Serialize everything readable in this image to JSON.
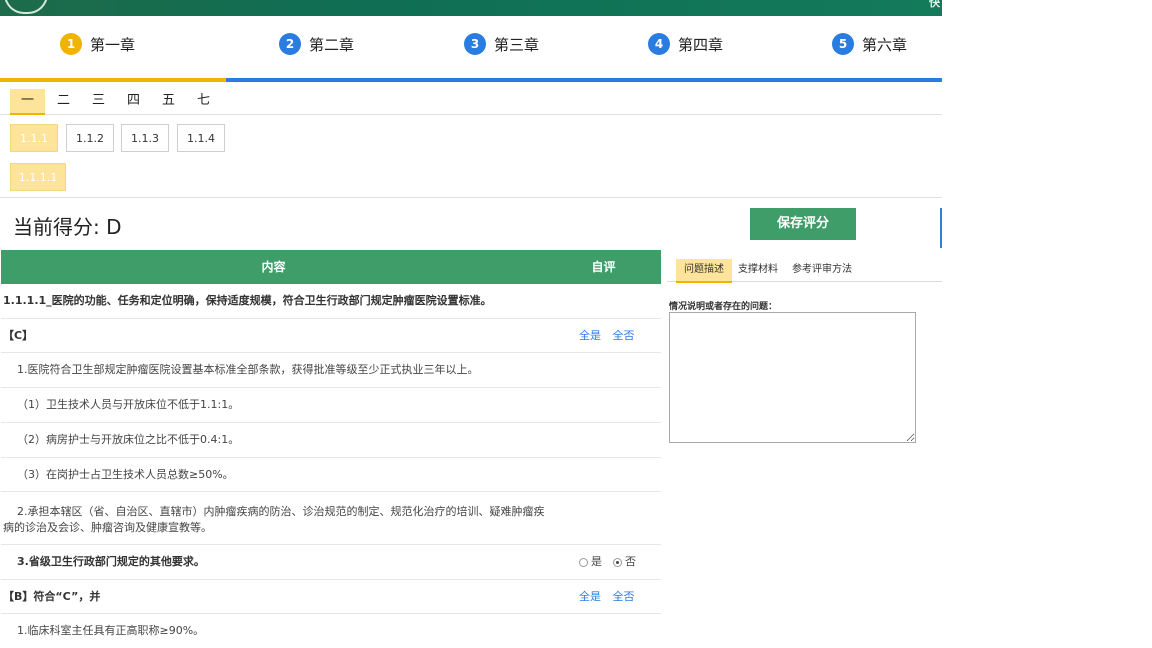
{
  "header": {
    "corner_text": "快"
  },
  "chapters": [
    {
      "num": "1",
      "label": "第一章",
      "active": true
    },
    {
      "num": "2",
      "label": "第二章",
      "active": false
    },
    {
      "num": "3",
      "label": "第三章",
      "active": false
    },
    {
      "num": "4",
      "label": "第四章",
      "active": false
    },
    {
      "num": "5",
      "label": "第六章",
      "active": false
    }
  ],
  "chapter_progress": 0.24,
  "section_tabs": [
    "一",
    "二",
    "三",
    "四",
    "五",
    "七"
  ],
  "sub_tabs": [
    "1.1.1",
    "1.1.2",
    "1.1.3",
    "1.1.4"
  ],
  "item_tab": "1.1.1.1",
  "score": {
    "text": "当前得分: D"
  },
  "save_button": "保存评分",
  "table": {
    "header_content": "内容",
    "header_self": "自评",
    "rows": [
      {
        "text": "1.1.1.1_医院的功能、任务和定位明确，保持适度规模，符合卫生行政部门规定肿瘤医院设置标准。"
      },
      {
        "text": "【C】",
        "all_yes": "全是",
        "all_no": "全否"
      },
      {
        "text": "1.医院符合卫生部规定肿瘤医院设置基本标准全部条款，获得批准等级至少正式执业三年以上。"
      },
      {
        "text": "（1）卫生技术人员与开放床位不低于1.1:1。"
      },
      {
        "text": "（2）病房护士与开放床位之比不低于0.4:1。"
      },
      {
        "text": "（3）在岗护士占卫生技术人员总数≥50%。"
      },
      {
        "text": "2.承担本辖区（省、自治区、直辖市）内肿瘤疾病的防治、诊治规范的制定、规范化治疗的培训、疑难肿瘤疾病的诊治及会诊、肿瘤咨询及健康宣教等。"
      },
      {
        "text": "3.省级卫生行政部门规定的其他要求。",
        "yes": "是",
        "no": "否"
      },
      {
        "text": "【B】符合“C”，并",
        "all_yes": "全是",
        "all_no": "全否"
      },
      {
        "text": "1.临床科室主任具有正高职称≥90%。"
      }
    ]
  },
  "right_panel": {
    "tabs": [
      "问题描述",
      "支撑材料",
      "参考评审方法"
    ],
    "question_label": "情况说明或者存在的问题：",
    "textarea_value": ""
  }
}
